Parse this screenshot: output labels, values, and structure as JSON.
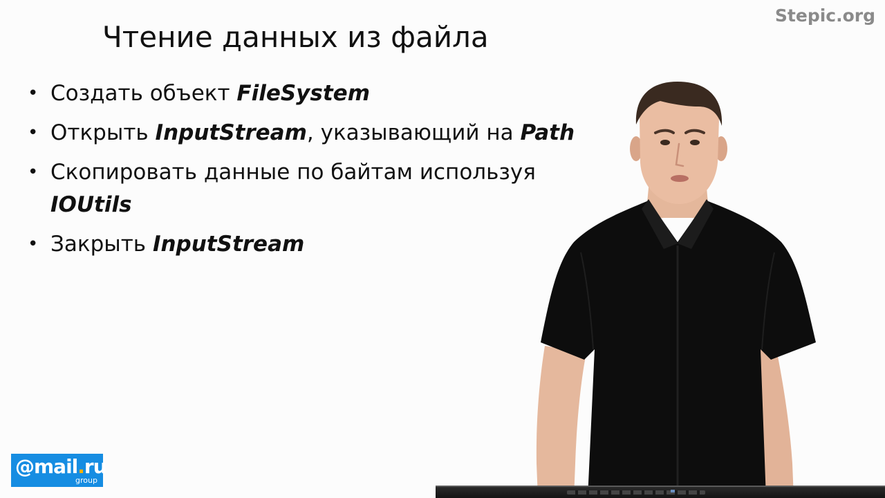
{
  "watermark": "Stepic.org",
  "slide": {
    "title": "Чтение данных из файла",
    "bullet_char": "•",
    "bullets": [
      {
        "text": "Создать объект ",
        "em": "FileSystem",
        "text_after": "",
        "em2": ""
      },
      {
        "text": "Открыть ",
        "em": "InputStream",
        "text_after": ", указывающий на ",
        "em2": "Path"
      },
      {
        "text": "Скопировать данные по байтам используя ",
        "em": "IOUtils",
        "text_after": "",
        "em2": ""
      },
      {
        "text": "Закрыть ",
        "em": "InputStream",
        "text_after": "",
        "em2": ""
      }
    ]
  },
  "logo": {
    "main": "@mail",
    "dot": ".",
    "ru": "ru",
    "sub": "group"
  },
  "colors": {
    "background": "#fcfcfc",
    "watermark": "#8a8a8a",
    "logo_bg": "#168de2",
    "logo_accent": "#ffb100",
    "shirt": "#0d0d0d"
  }
}
